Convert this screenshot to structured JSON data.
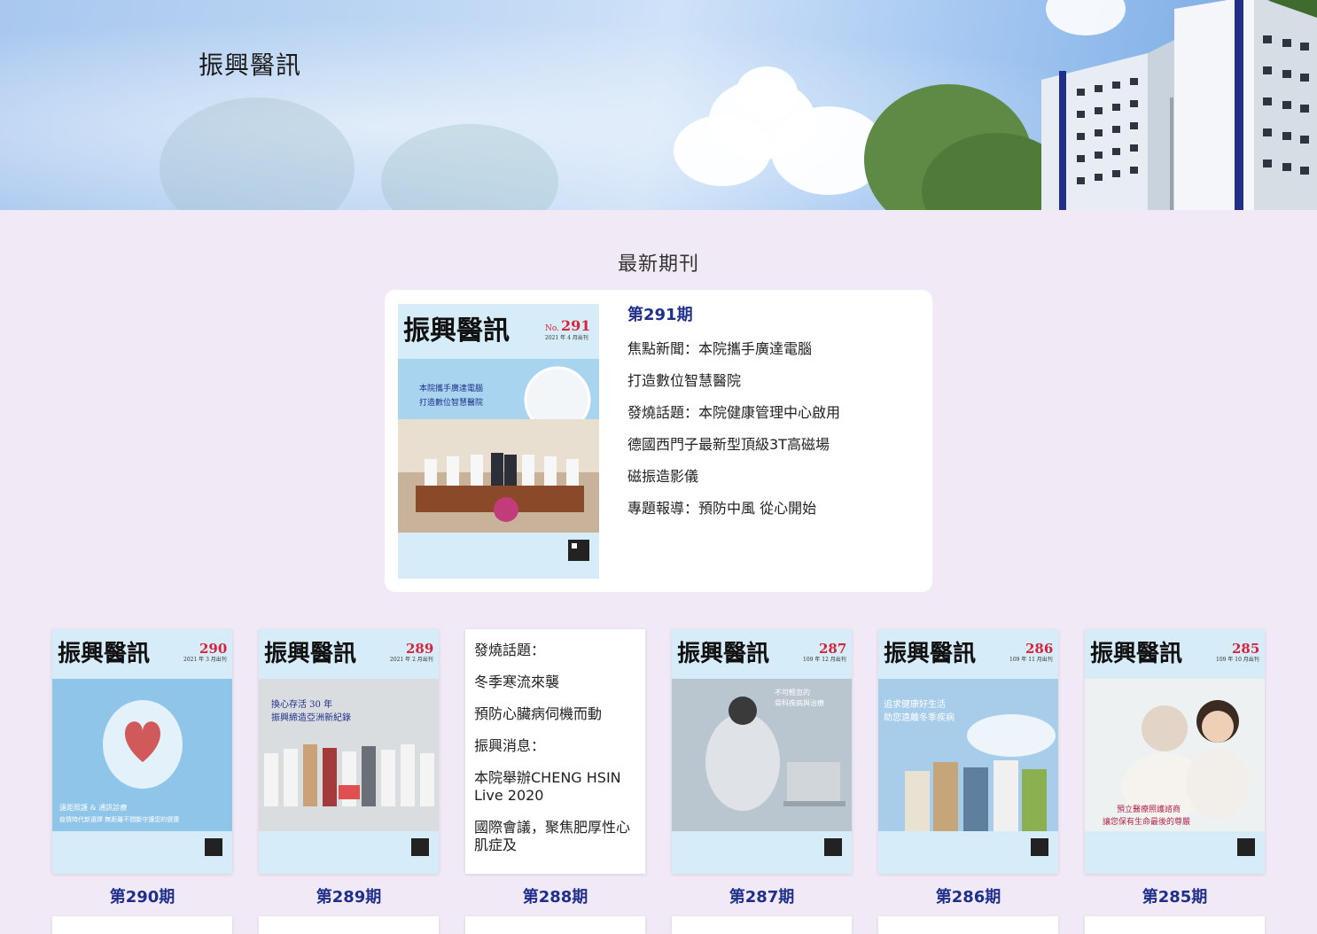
{
  "hero": {
    "title": "振興醫訊"
  },
  "section_title": "最新期刊",
  "featured": {
    "issue": "第291期",
    "lines": [
      "焦點新聞：本院攜手廣達電腦",
      "打造數位智慧醫院",
      "發燒話題：本院健康管理中心啟用",
      "德國西門子最新型頂級3T高磁場",
      "磁振造影儀",
      "專題報導：預防中風  從心開始"
    ],
    "cover": {
      "masthead": "振興醫訊",
      "no": "291",
      "date": "2021 年 4 月出刊",
      "headline1": "本院攜手廣達電腦",
      "headline2": "打造數位智慧醫院",
      "accent": "#d8233a"
    }
  },
  "issues": [
    {
      "label": "第290期",
      "no": "290",
      "date": "2021 年 3 月出刊",
      "headline1": "遠距照護 & 通訊診療",
      "headline2": "疫情時代新選擇  無距離不間斷守護您的健康",
      "theme": "#8ec5e8"
    },
    {
      "label": "第289期",
      "no": "289",
      "date": "2021 年 2 月出刊",
      "headline1": "換心存活 30 年",
      "headline2": "振興締造亞洲新紀錄",
      "theme": "#d9dde0"
    },
    {
      "label": "第288期",
      "text_lines": [
        "發燒話題：",
        "冬季寒流來襲",
        "預防心臟病伺機而動",
        "振興消息：",
        "本院舉辦CHENG HSIN Live 2020",
        "國際會議，聚焦肥厚性心肌症及"
      ]
    },
    {
      "label": "第287期",
      "no": "287",
      "date": "109 年 12 月出刊",
      "headline1": "不可輕忽的",
      "headline2": "骨科疾病與治療",
      "theme": "#b9c6cf"
    },
    {
      "label": "第286期",
      "no": "286",
      "date": "109 年 11 月出刊",
      "headline1": "追求健康好生活",
      "headline2": "助您遠離冬季疾病",
      "theme": "#a7cdeb"
    },
    {
      "label": "第285期",
      "no": "285",
      "date": "109 年 10 月出刊",
      "headline1": "預立醫療照護諮商",
      "headline2": "讓您保有生命最後的尊嚴",
      "theme": "#eef1f1"
    }
  ],
  "colors": {
    "issue_label": "#1f2f8a",
    "page_bg": "#f1eaf6",
    "masthead_red": "#d8233a"
  }
}
